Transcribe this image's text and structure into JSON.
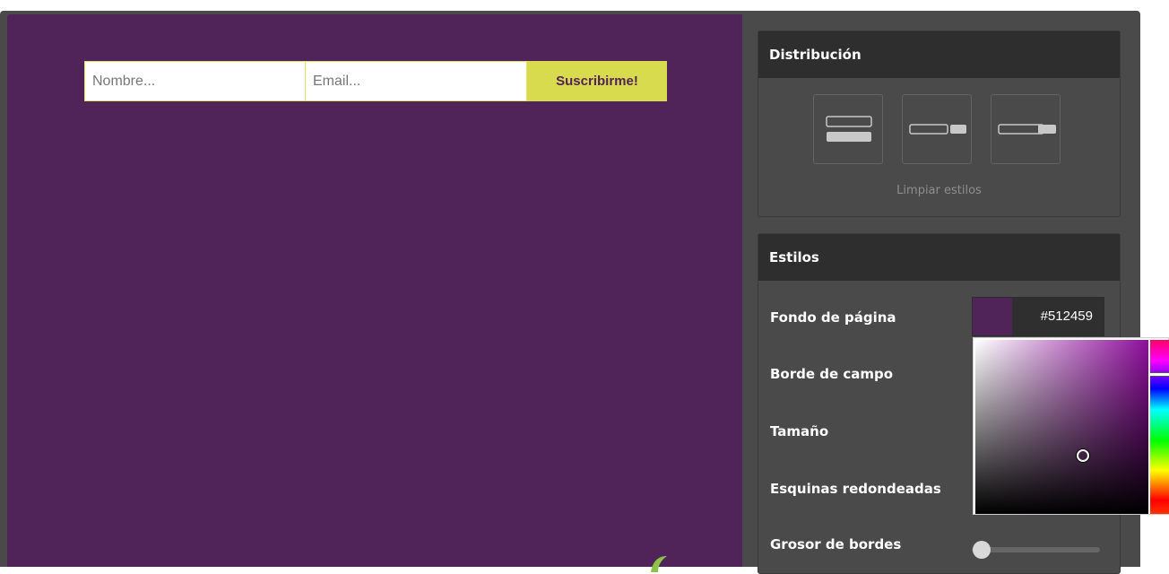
{
  "preview": {
    "background_color": "#512459",
    "name_placeholder": "Nombre...",
    "email_placeholder": "Email...",
    "submit_label": "Suscribirme!",
    "accent_color": "#d8db4e"
  },
  "distribucion": {
    "title": "Distribución",
    "layouts": [
      "stacked-layout-icon",
      "inline-small-button-layout-icon",
      "inline-large-button-layout-icon"
    ],
    "clear_label": "Limpiar estilos"
  },
  "estilos": {
    "title": "Estilos",
    "page_background_label": "Fondo de página",
    "page_background_value": "#512459",
    "field_border_label": "Borde de campo",
    "size_label": "Tamaño",
    "rounded_corners_label": "Esquinas redondeadas",
    "border_width_label": "Grosor de bordes",
    "border_width_level": 0
  }
}
